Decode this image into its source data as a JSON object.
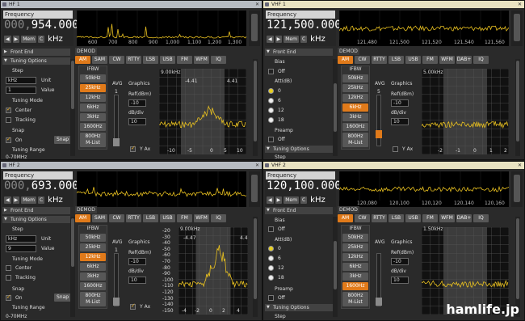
{
  "panes": [
    {
      "title": "HF 1",
      "freq_dim": "000,",
      "freq_main": "954.000",
      "spec_ticks": [
        "600",
        "700",
        "800",
        "900",
        "1,000",
        "1,100",
        "1,200",
        "1,300"
      ],
      "front_end": "Front End",
      "tuning": "Tuning Options",
      "step": "Step",
      "step_unit_val": "kHz",
      "step_unit_lbl": "Unit",
      "step_value_val": "1",
      "step_value_lbl": "Value",
      "tuning_mode": "Tuning Mode",
      "center": "Center",
      "tracking": "Tracking",
      "snap": "Snap",
      "on": "On",
      "snap_btn": "Snap",
      "range": "Tuning Range",
      "range_val": "0-70MHz",
      "ifbw_sel": 1,
      "ifbw": [
        "50kHz",
        "25kHz",
        "12kHz",
        "6kHz",
        "3kHz",
        "1600Hz",
        "800Hz"
      ],
      "mlist": "M-List",
      "avg": "AVG",
      "avg_val": "1",
      "graphics": "Graphics",
      "ref": "Ref(dBm)",
      "ref_val": "-10",
      "dbdiv": "dB/div",
      "dbdiv_val": "10",
      "yax": "Y Ax",
      "scope_top": "9.00kHz",
      "scope_l": "-4.41",
      "scope_r": "4.41",
      "scope_ticks": [
        "-10",
        "-5",
        "0",
        "5",
        "10"
      ]
    },
    {
      "title": "VHF 1",
      "freq_dim": "",
      "freq_main": "121,500.000",
      "spec_ticks": [
        "121,480",
        "121,500",
        "121,520",
        "121,540",
        "121,560"
      ],
      "front_end": "Front End",
      "bias": "Bias",
      "off": "Off",
      "att": "Att(dB)",
      "att_vals": [
        "0",
        "6",
        "12",
        "18"
      ],
      "preamp": "Preamp",
      "tuning": "Tuning Options",
      "step": "Step",
      "ifbw_sel": 3,
      "ifbw": [
        "50kHz",
        "25kHz",
        "12kHz",
        "6kHz",
        "3kHz",
        "1600Hz",
        "800Hz"
      ],
      "mlist": "M-List",
      "avg": "AVG",
      "avg_val": "5",
      "graphics": "Graphics",
      "ref": "Ref(dBm)",
      "ref_val": "-10",
      "dbdiv": "dB/div",
      "dbdiv_val": "10",
      "yax": "Y Ax",
      "scope_top": "5.00kHz",
      "scope_ticks": [
        "-2",
        "-1",
        "0",
        "1",
        "2"
      ]
    },
    {
      "title": "HF 2",
      "freq_dim": "000,",
      "freq_main": "693.000",
      "spec_ticks": [],
      "front_end": "Front End",
      "tuning": "Tuning Options",
      "step": "Step",
      "step_unit_val": "kHz",
      "step_unit_lbl": "Unit",
      "step_value_val": "9",
      "step_value_lbl": "Value",
      "tuning_mode": "Tuning Mode",
      "center": "Center",
      "tracking": "Tracking",
      "snap": "Snap",
      "on": "On",
      "snap_btn": "Snap",
      "range": "Tuning Range",
      "range_val": "0-70MHz",
      "ifbw_sel": 2,
      "ifbw": [
        "50kHz",
        "25kHz",
        "12kHz",
        "6kHz",
        "3kHz",
        "1600Hz",
        "800Hz"
      ],
      "mlist": "M-List",
      "avg": "AVG",
      "avg_val": "1",
      "graphics": "Graphics",
      "ref": "Ref(dBm)",
      "ref_val": "-10",
      "dbdiv": "dB/div",
      "dbdiv_val": "10",
      "yax": "Y Ax",
      "scope_top": "9.00kHz",
      "scope_l": "-4.47",
      "scope_r": "4.4",
      "scope_ticks": [
        "-4",
        "-2",
        "0",
        "2",
        "4"
      ],
      "y_labels": [
        "-20",
        "-30",
        "-40",
        "-50",
        "-60",
        "-70",
        "-80",
        "-90",
        "-100",
        "-110",
        "-120",
        "-130",
        "-140",
        "-150"
      ]
    },
    {
      "title": "VHF 2",
      "freq_dim": "",
      "freq_main": "120,100.000",
      "spec_ticks": [
        "120,080",
        "120,100",
        "120,120",
        "120,140",
        "120,160"
      ],
      "front_end": "Front End",
      "bias": "Bias",
      "off": "Off",
      "att": "Att(dB)",
      "att_vals": [
        "0",
        "6",
        "12",
        "18"
      ],
      "preamp": "Preamp",
      "tuning": "Tuning Options",
      "step": "Step",
      "ifbw_sel": 5,
      "ifbw": [
        "50kHz",
        "25kHz",
        "12kHz",
        "6kHz",
        "3kHz",
        "1600Hz",
        "800Hz"
      ],
      "mlist": "M-List",
      "avg": "AVG",
      "avg_val": "",
      "graphics": "Graphics",
      "ref": "Ref(dBm)",
      "ref_val": "-10",
      "dbdiv": "dB/div",
      "dbdiv_val": "10",
      "yax": "Y Ax",
      "scope_top": "1.50kHz",
      "scope_ticks": []
    }
  ],
  "common": {
    "frequency": "Frequency",
    "mem": "Mem",
    "c": "C",
    "unit": "kHz",
    "demod": "DEMOD",
    "ifbw_title": "IFBW",
    "close": "✕"
  },
  "hf_modes": [
    "AM",
    "SAM",
    "CW",
    "RTTY",
    "LSB",
    "USB",
    "FM",
    "WFM",
    "IQ"
  ],
  "vhf_modes": [
    "AM",
    "CW",
    "RTTY",
    "LSB",
    "USB",
    "FM",
    "WFM",
    "DAB+",
    "IQ"
  ],
  "watermark": "hamlife.jp",
  "colors": {
    "accent": "#e07a1a",
    "trace": "#e8c020",
    "hf_title": "#b7bcc2",
    "vhf_title": "#e9e3c2"
  }
}
